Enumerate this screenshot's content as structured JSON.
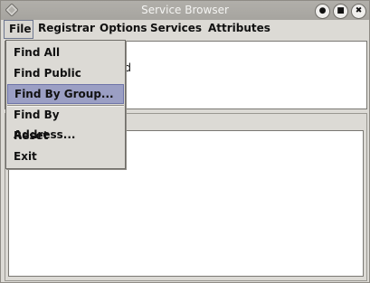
{
  "window": {
    "title": "Service Browser"
  },
  "menubar": {
    "items": [
      "File",
      "Registrar",
      "Options",
      "Services",
      "Attributes"
    ]
  },
  "file_menu": {
    "items": [
      "Find All",
      "Find Public",
      "Find By Group...",
      "Find By Address...",
      "Reset",
      "Exit"
    ],
    "selected": "Find By Group..."
  },
  "top_panel": {
    "visible_text": "ed"
  },
  "colors": {
    "selection": "#9b9fc4",
    "titlebar": "#a6a49f"
  }
}
